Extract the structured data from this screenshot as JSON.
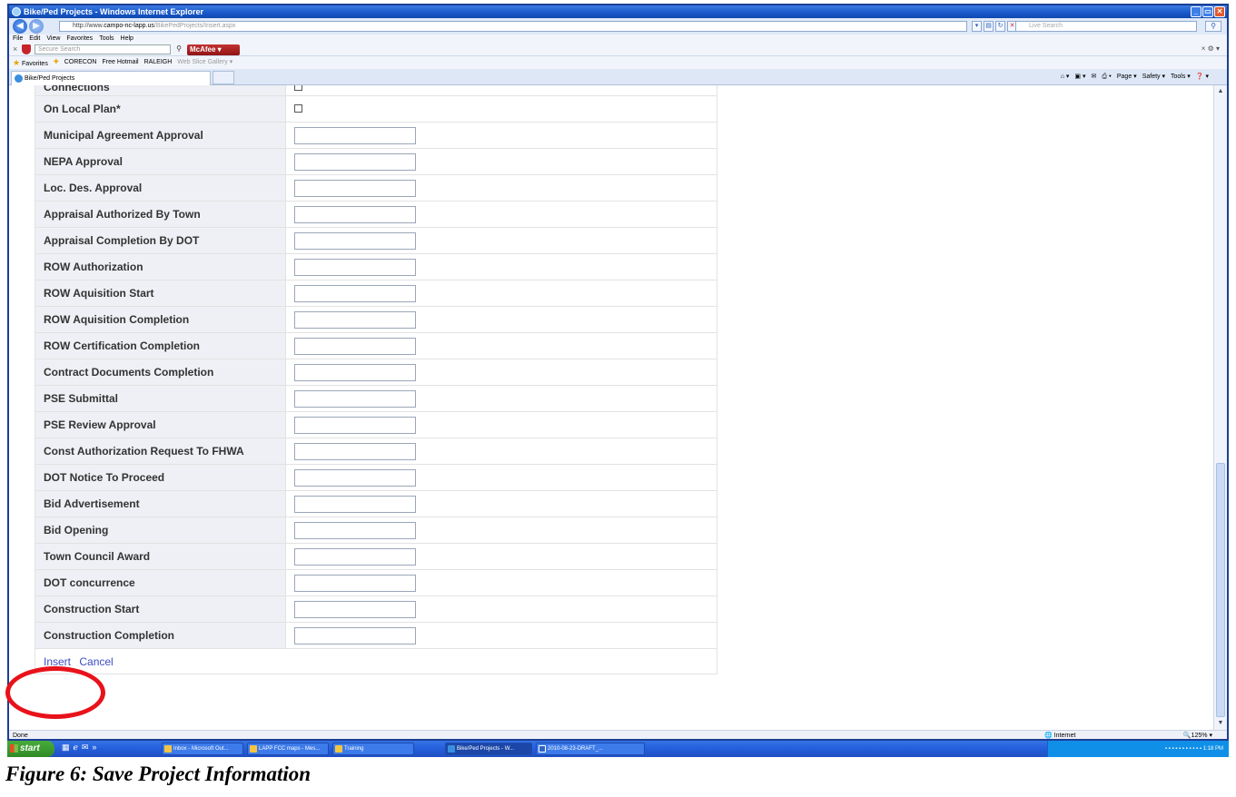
{
  "window": {
    "title": "Bike/Ped Projects - Windows Internet Explorer",
    "controls": [
      "_",
      "▭",
      "✕"
    ]
  },
  "address_bar": {
    "url_prefix": "http://www.",
    "url_host": "campo-nc-lapp.us",
    "url_path": "/BikePedProjects/Insert.aspx",
    "search_placeholder": "Live Search"
  },
  "menu": [
    "File",
    "Edit",
    "View",
    "Favorites",
    "Tools",
    "Help"
  ],
  "mcafee": {
    "search_placeholder": "Secure Search",
    "brand": "McAfee"
  },
  "favorites_bar": {
    "label": "Favorites",
    "items": [
      "CORECON",
      "Free Hotmail",
      "RALEIGH"
    ],
    "faded_item": "Web Slice Gallery ▾"
  },
  "tab": {
    "title": "Bike/Ped Projects"
  },
  "command_bar": [
    "Page ▾",
    "Safety ▾",
    "Tools ▾"
  ],
  "form": {
    "partial_row_label": "Connections",
    "checkbox_rows": [
      "On Local Plan*"
    ],
    "date_rows": [
      "Municipal Agreement Approval",
      "NEPA Approval",
      "Loc. Des. Approval",
      "Appraisal Authorized By Town",
      "Appraisal Completion By DOT",
      "ROW Authorization",
      "ROW Aquisition Start",
      "ROW Aquisition Completion",
      "ROW Certification Completion",
      "Contract Documents Completion",
      "PSE Submittal",
      "PSE Review Approval",
      "Const Authorization Request To FHWA",
      "DOT Notice To Proceed",
      "Bid Advertisement",
      "Bid Opening",
      "Town Council Award",
      "DOT concurrence",
      "Construction Start",
      "Construction Completion"
    ],
    "actions": {
      "insert": "Insert",
      "cancel": "Cancel"
    }
  },
  "status_bar": {
    "left": "Done",
    "zone": "Internet",
    "zoom": "125%"
  },
  "taskbar": {
    "start": "start",
    "tasks": [
      "Inbox - Microsoft Out...",
      "LAPP FCC maps - Mes...",
      "Training",
      "Bike/Ped Projects - W...",
      "2010-08-23-DRAFT_..."
    ],
    "clock": "1:18 PM"
  },
  "caption": "Figure 6: Save Project Information",
  "colors": {
    "highlight": "#e8121b",
    "label_bg": "#eef0f5",
    "link": "#3a4cc4"
  }
}
